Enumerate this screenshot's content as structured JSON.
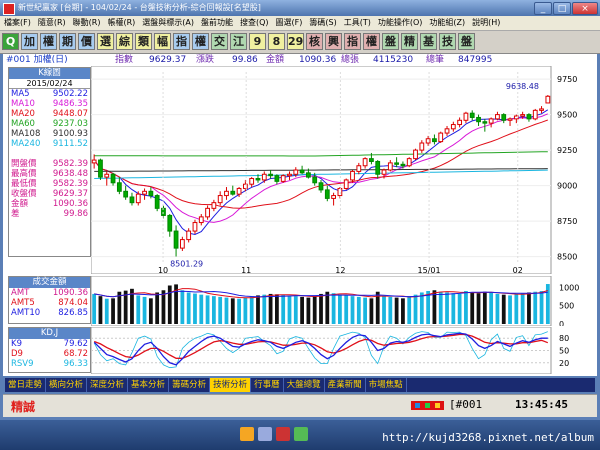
{
  "window": {
    "title": "新世紀贏家 [台期] - 104/02/24 - 台盤技術分析-綜合回報設[名望股]"
  },
  "menu": [
    "檔案(F)",
    "隨意(R)",
    "聯動(R)",
    "帳權(R)",
    "選盤與標示(A)",
    "盤前功能",
    "搜查(Q)",
    "圖選(F)",
    "籌碼(S)",
    "工具(T)",
    "功能操作(O)",
    "功能組(Z)",
    "說明(H)"
  ],
  "toolbar": [
    "Q",
    "加",
    "權",
    "期",
    "價",
    "選",
    "綜",
    "類",
    "幅",
    "指",
    "權",
    "交",
    "江",
    "9",
    "8",
    "29",
    "核",
    "興",
    "指",
    "權",
    "盤",
    "精",
    "基",
    "技",
    "盤"
  ],
  "quote": {
    "symbol": "#001 加權(日)",
    "l1": "指數",
    "v1": "9629.37",
    "l2": "漲跌",
    "v2": "99.86",
    "l3": "金額",
    "v3": "1090.36",
    "l4": "總張",
    "v4": "4115230",
    "l5": "總筆",
    "v5": "847995"
  },
  "kpanel": {
    "title": "K線圖",
    "date": "2015/02/24",
    "ma": [
      {
        "name": "MA5",
        "value": "9502.22",
        "color": "#1e1ee0"
      },
      {
        "name": "MA10",
        "value": "9486.35",
        "color": "#d81ad8"
      },
      {
        "name": "MA20",
        "value": "9448.07",
        "color": "#e0101a"
      },
      {
        "name": "MA60",
        "value": "9237.03",
        "color": "#22a422"
      },
      {
        "name": "MA108",
        "value": "9100.93",
        "color": "#303030"
      },
      {
        "name": "MA240",
        "value": "9111.52",
        "color": "#1ab6e0"
      }
    ],
    "prices": [
      {
        "name": "開盤價",
        "value": "9582.39"
      },
      {
        "name": "最高價",
        "value": "9638.48"
      },
      {
        "name": "最低價",
        "value": "9582.39"
      },
      {
        "name": "收盤價",
        "value": "9629.37"
      },
      {
        "name": "金額",
        "value": "1090.36"
      },
      {
        "name": "差",
        "value": "99.86"
      }
    ]
  },
  "vpanel": {
    "title": "成交金額",
    "rows": [
      {
        "name": "AMT",
        "value": "1090.36"
      },
      {
        "name": "AMT5",
        "value": "874.04"
      },
      {
        "name": "AMT10",
        "value": "826.85"
      }
    ]
  },
  "kdpanel": {
    "title": "KD,J",
    "rows": [
      {
        "name": "K9",
        "value": "79.62",
        "color": "#1e1ee0"
      },
      {
        "name": "D9",
        "value": "68.72",
        "color": "#e0101a"
      },
      {
        "name": "RSV9",
        "value": "96.33",
        "color": "#1ab6e0"
      }
    ]
  },
  "chart_data": {
    "type": "candlestick",
    "price_axis": {
      "ticks": [
        "9750",
        "9500",
        "9250",
        "9000",
        "8750",
        "8500"
      ],
      "ymin": 8420,
      "ymax": 9800
    },
    "high_label": "9638.48",
    "low_label": "8501.29",
    "x_labels": [
      "10",
      "11",
      "12",
      "15/01",
      "02"
    ],
    "candles": [
      [
        9160,
        9220,
        9120,
        9180
      ],
      [
        9180,
        9190,
        9040,
        9060
      ],
      [
        9060,
        9100,
        9000,
        9080
      ],
      [
        9080,
        9090,
        9000,
        9020
      ],
      [
        9020,
        9060,
        8940,
        8960
      ],
      [
        8960,
        9000,
        8900,
        8920
      ],
      [
        8920,
        8950,
        8860,
        8880
      ],
      [
        8880,
        8960,
        8860,
        8940
      ],
      [
        8940,
        8980,
        8900,
        8960
      ],
      [
        8960,
        8990,
        8910,
        8930
      ],
      [
        8930,
        8940,
        8820,
        8840
      ],
      [
        8840,
        8860,
        8770,
        8790
      ],
      [
        8790,
        8800,
        8640,
        8680
      ],
      [
        8680,
        8720,
        8501,
        8560
      ],
      [
        8560,
        8640,
        8540,
        8620
      ],
      [
        8620,
        8700,
        8600,
        8680
      ],
      [
        8680,
        8760,
        8660,
        8740
      ],
      [
        8740,
        8800,
        8720,
        8780
      ],
      [
        8780,
        8860,
        8760,
        8840
      ],
      [
        8840,
        8900,
        8820,
        8880
      ],
      [
        8880,
        8960,
        8860,
        8930
      ],
      [
        8930,
        8990,
        8900,
        8960
      ],
      [
        8960,
        9000,
        8930,
        8940
      ],
      [
        8940,
        8990,
        8920,
        8980
      ],
      [
        8980,
        9040,
        8960,
        9010
      ],
      [
        9010,
        9060,
        8990,
        9050
      ],
      [
        9050,
        9080,
        9020,
        9040
      ],
      [
        9040,
        9100,
        9020,
        9080
      ],
      [
        9080,
        9110,
        9050,
        9070
      ],
      [
        9070,
        9080,
        9010,
        9030
      ],
      [
        9030,
        9080,
        9020,
        9070
      ],
      [
        9070,
        9100,
        9040,
        9080
      ],
      [
        9080,
        9130,
        9060,
        9110
      ],
      [
        9110,
        9140,
        9080,
        9090
      ],
      [
        9090,
        9120,
        9050,
        9060
      ],
      [
        9060,
        9090,
        9000,
        9020
      ],
      [
        9020,
        9040,
        8950,
        8970
      ],
      [
        8970,
        9000,
        8890,
        8910
      ],
      [
        8910,
        8950,
        8860,
        8930
      ],
      [
        8930,
        8990,
        8910,
        8980
      ],
      [
        8980,
        9050,
        8970,
        9040
      ],
      [
        9040,
        9110,
        9020,
        9100
      ],
      [
        9100,
        9160,
        9080,
        9140
      ],
      [
        9140,
        9200,
        9120,
        9190
      ],
      [
        9190,
        9230,
        9150,
        9170
      ],
      [
        9170,
        9180,
        9050,
        9080
      ],
      [
        9080,
        9120,
        9050,
        9110
      ],
      [
        9110,
        9180,
        9100,
        9160
      ],
      [
        9160,
        9200,
        9130,
        9150
      ],
      [
        9150,
        9170,
        9120,
        9140
      ],
      [
        9140,
        9200,
        9130,
        9190
      ],
      [
        9190,
        9260,
        9180,
        9250
      ],
      [
        9250,
        9320,
        9230,
        9300
      ],
      [
        9300,
        9350,
        9280,
        9330
      ],
      [
        9330,
        9360,
        9290,
        9310
      ],
      [
        9310,
        9380,
        9300,
        9370
      ],
      [
        9370,
        9420,
        9350,
        9400
      ],
      [
        9400,
        9450,
        9380,
        9430
      ],
      [
        9430,
        9480,
        9410,
        9460
      ],
      [
        9460,
        9520,
        9440,
        9510
      ],
      [
        9510,
        9530,
        9460,
        9480
      ],
      [
        9480,
        9500,
        9420,
        9450
      ],
      [
        9450,
        9470,
        9380,
        9440
      ],
      [
        9440,
        9480,
        9410,
        9470
      ],
      [
        9470,
        9520,
        9460,
        9500
      ],
      [
        9500,
        9510,
        9440,
        9460
      ],
      [
        9460,
        9480,
        9420,
        9470
      ],
      [
        9470,
        9500,
        9440,
        9490
      ],
      [
        9490,
        9520,
        9470,
        9500
      ],
      [
        9500,
        9510,
        9450,
        9470
      ],
      [
        9470,
        9540,
        9460,
        9530
      ],
      [
        9530,
        9560,
        9510,
        9540
      ],
      [
        9582,
        9638,
        9582,
        9629
      ]
    ],
    "volume_axis": {
      "ticks": [
        "1000",
        "500",
        "0"
      ],
      "max": 1200
    },
    "volume": [
      820,
      760,
      690,
      700,
      880,
      910,
      960,
      780,
      740,
      700,
      860,
      920,
      1050,
      1080,
      920,
      860,
      830,
      800,
      780,
      760,
      740,
      720,
      700,
      690,
      720,
      760,
      780,
      800,
      820,
      810,
      790,
      770,
      760,
      740,
      720,
      760,
      820,
      880,
      840,
      800,
      780,
      760,
      740,
      720,
      700,
      880,
      760,
      740,
      720,
      700,
      760,
      800,
      860,
      900,
      920,
      880,
      860,
      840,
      820,
      900,
      860,
      840,
      880,
      860,
      820,
      800,
      780,
      820,
      840,
      860,
      880,
      900,
      1090
    ],
    "kd_axis": {
      "ticks": [
        "80",
        "50",
        "20"
      ],
      "min": 0,
      "max": 100
    },
    "k": [
      70,
      55,
      40,
      35,
      28,
      22,
      30,
      50,
      65,
      70,
      55,
      35,
      20,
      15,
      30,
      48,
      60,
      72,
      82,
      85,
      80,
      70,
      60,
      58,
      66,
      72,
      76,
      74,
      70,
      60,
      55,
      62,
      70,
      74,
      68,
      55,
      40,
      30,
      38,
      55,
      70,
      82,
      88,
      86,
      70,
      50,
      55,
      68,
      72,
      70,
      74,
      82,
      88,
      90,
      86,
      84,
      88,
      90,
      92,
      90,
      78,
      62,
      55,
      62,
      72,
      66,
      60,
      68,
      74,
      70,
      76,
      80,
      80
    ],
    "d": [
      72,
      66,
      57,
      50,
      42,
      35,
      33,
      39,
      48,
      55,
      55,
      48,
      39,
      31,
      31,
      37,
      45,
      54,
      63,
      71,
      74,
      72,
      68,
      65,
      65,
      68,
      71,
      72,
      71,
      67,
      63,
      63,
      65,
      68,
      68,
      64,
      56,
      47,
      44,
      48,
      55,
      64,
      72,
      77,
      75,
      67,
      63,
      65,
      67,
      68,
      70,
      74,
      79,
      83,
      84,
      84,
      85,
      87,
      89,
      89,
      85,
      78,
      70,
      67,
      69,
      68,
      66,
      66,
      69,
      69,
      72,
      75,
      69
    ],
    "rsv": [
      68,
      40,
      25,
      30,
      18,
      15,
      45,
      80,
      85,
      78,
      35,
      15,
      8,
      10,
      55,
      70,
      80,
      85,
      92,
      88,
      72,
      55,
      45,
      55,
      80,
      82,
      84,
      72,
      62,
      42,
      48,
      78,
      84,
      80,
      55,
      32,
      18,
      18,
      55,
      85,
      90,
      95,
      92,
      82,
      38,
      18,
      60,
      85,
      80,
      66,
      82,
      92,
      96,
      94,
      82,
      82,
      95,
      94,
      95,
      86,
      55,
      30,
      40,
      76,
      90,
      55,
      48,
      82,
      86,
      62,
      88,
      90,
      96
    ]
  },
  "bottom_tabs": [
    "當日走勢",
    "橫向分析",
    "深度分析",
    "基本分析",
    "籌碼分析",
    "技術分析",
    "行事曆",
    "大盤總覽",
    "產業新聞",
    "市場焦點"
  ],
  "status": {
    "name": "精誠",
    "code": "[#001",
    "time": "13:45:45"
  },
  "watermark": "http://kujd3268.pixnet.net/album"
}
